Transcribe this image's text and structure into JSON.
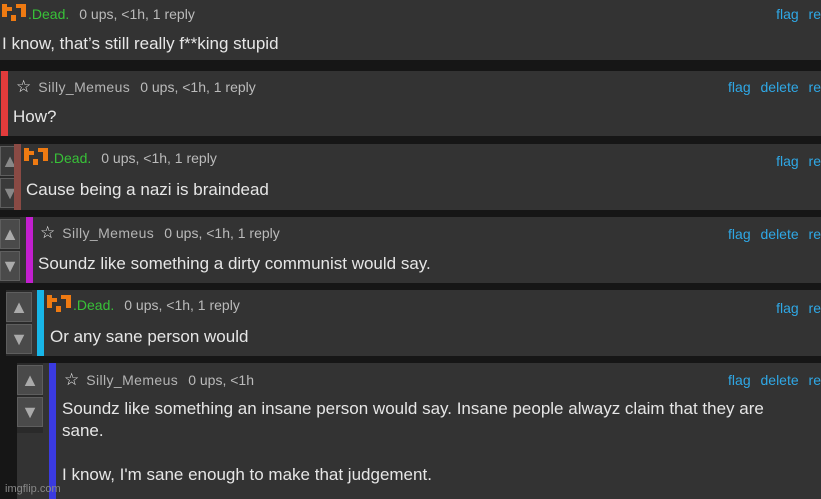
{
  "colors": {
    "bars": [
      "#e23b3b",
      "#8a4a44",
      "#c21fcf",
      "#18b6e8",
      "#3a3ae0"
    ],
    "link": "#2fa8e6",
    "user_green": "#38c238"
  },
  "icons": {
    "dead_avatar": "pixel-face-icon",
    "meme_avatar": "star-icon",
    "upvote": "up-arrow-icon",
    "downvote": "down-arrow-icon"
  },
  "comments": [
    {
      "user": ".Dead.",
      "meta": "0 ups, <1h, 1 reply",
      "actions": [
        "flag",
        "re"
      ],
      "body": "I know, that’s still really f**king stupid"
    },
    {
      "user": "Silly_Memeus",
      "meta": "0 ups, <1h, 1 reply",
      "actions": [
        "flag",
        "delete",
        "re"
      ],
      "body": "How?"
    },
    {
      "user": ".Dead.",
      "meta": "0 ups, <1h, 1 reply",
      "actions": [
        "flag",
        "re"
      ],
      "body": "Cause being a nazi is braindead"
    },
    {
      "user": "Silly_Memeus",
      "meta": "0 ups, <1h, 1 reply",
      "actions": [
        "flag",
        "delete",
        "re"
      ],
      "body": "Soundz like something a dirty communist would say."
    },
    {
      "user": ".Dead.",
      "meta": "0 ups, <1h, 1 reply",
      "actions": [
        "flag",
        "re"
      ],
      "body": "Or any sane person would"
    },
    {
      "user": "Silly_Memeus",
      "meta": "0 ups, <1h",
      "actions": [
        "flag",
        "delete",
        "re"
      ],
      "body": "Soundz like something an insane person would say. Insane people alwayz claim that they are\nsane.\n\nI know, I'm sane enough to make that judgement."
    }
  ],
  "watermark": "imgflip.com"
}
